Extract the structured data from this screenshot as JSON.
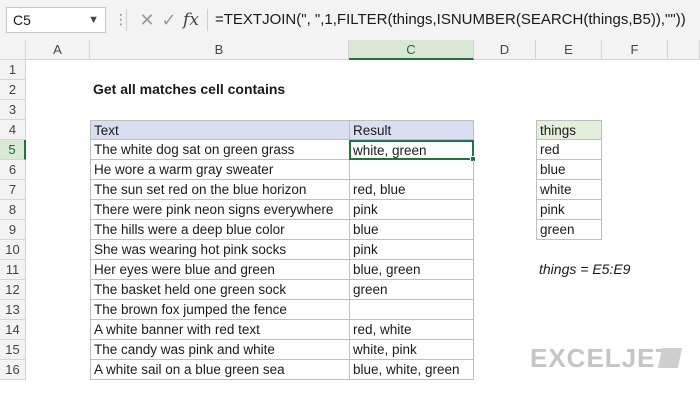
{
  "formula_bar": {
    "name_box": "C5",
    "name_box_dropdown_icon": "chevron-down-icon",
    "more_icon": "vertical-dots-icon",
    "cancel_icon": "close-icon",
    "enter_icon": "check-icon",
    "function_icon": "function-icon",
    "function_label": "fx",
    "formula": "=TEXTJOIN(\", \",1,FILTER(things,ISNUMBER(SEARCH(things,B5)),\"\"))"
  },
  "columns": [
    "A",
    "B",
    "C",
    "D",
    "E",
    "F"
  ],
  "selected_column": "C",
  "rows": [
    "1",
    "2",
    "3",
    "4",
    "5",
    "6",
    "7",
    "8",
    "9",
    "10",
    "11",
    "12",
    "13",
    "14",
    "15",
    "16"
  ],
  "selected_row": "5",
  "title": "Get all matches cell contains",
  "table": {
    "headers": [
      "Text",
      "Result"
    ],
    "rows": [
      [
        "The white dog sat on green grass",
        "white, green"
      ],
      [
        "He wore a warm gray sweater",
        ""
      ],
      [
        "The sun set red on the blue horizon",
        "red, blue"
      ],
      [
        "There were pink neon signs everywhere",
        "pink"
      ],
      [
        "The hills were a deep blue color",
        "blue"
      ],
      [
        "She was wearing hot pink socks",
        "pink"
      ],
      [
        "Her eyes were blue and green",
        "blue, green"
      ],
      [
        "The basket held one green sock",
        "green"
      ],
      [
        "The brown fox jumped the fence",
        ""
      ],
      [
        "A white banner with red text",
        "red, white"
      ],
      [
        "The candy was pink and white",
        "white, pink"
      ],
      [
        "A white sail on a blue green sea",
        "blue, white, green"
      ]
    ]
  },
  "things": {
    "header": "things",
    "items": [
      "red",
      "blue",
      "white",
      "pink",
      "green"
    ]
  },
  "named_range_note": "things = E5:E9",
  "logo": {
    "text": "EXCELJET"
  },
  "colors": {
    "selection": "#217346",
    "table_header": "#d9dff3",
    "things_header": "#e3efdb"
  }
}
